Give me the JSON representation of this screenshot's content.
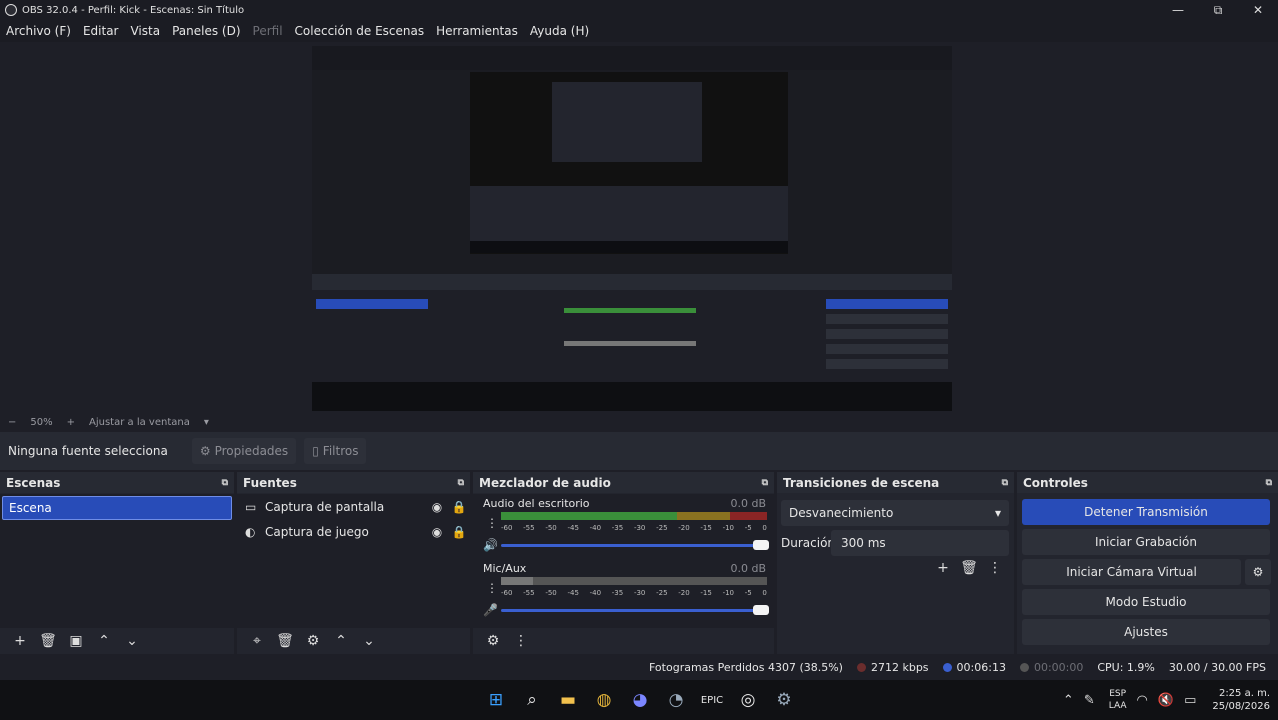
{
  "window": {
    "title": "OBS 32.0.4 - Perfil: Kick - Escenas: Sin Título",
    "minimize": "—",
    "maximize": "⧉",
    "close": "✕"
  },
  "menu": [
    "Archivo (F)",
    "Editar",
    "Vista",
    "Paneles (D)",
    "Perfil",
    "Colección de Escenas",
    "Herramientas",
    "Ayuda (H)"
  ],
  "zoom": {
    "minus": "−",
    "level": "50%",
    "plus": "+",
    "fit": "Ajustar a la ventana",
    "caret": "▾"
  },
  "source_toolbar": {
    "none_selected": "Ninguna fuente selecciona",
    "properties": "Propiedades",
    "filters": "Filtros"
  },
  "scenes": {
    "title": "Escenas",
    "items": [
      "Escena"
    ]
  },
  "sources": {
    "title": "Fuentes",
    "items": [
      {
        "label": "Captura de pantalla",
        "icon": "monitor-icon"
      },
      {
        "label": "Captura de juego",
        "icon": "gamepad-icon"
      }
    ]
  },
  "mixer": {
    "title": "Mezclador de audio",
    "ticks": [
      "-60",
      "-55",
      "-50",
      "-45",
      "-40",
      "-35",
      "-30",
      "-25",
      "-20",
      "-15",
      "-10",
      "-5",
      "0"
    ],
    "channels": [
      {
        "name": "Audio del escritorio",
        "db": "0.0 dB",
        "muted": false
      },
      {
        "name": "Mic/Aux",
        "db": "0.0 dB",
        "muted": true
      }
    ]
  },
  "transitions": {
    "title": "Transiciones de escena",
    "selected": "Desvanecimiento",
    "duration_label": "Duración",
    "duration_value": "300 ms"
  },
  "controls": {
    "title": "Controles",
    "stop_stream": "Detener Transmisión",
    "start_record": "Iniciar Grabación",
    "virtual_cam": "Iniciar Cámara Virtual",
    "studio_mode": "Modo Estudio",
    "settings": "Ajustes"
  },
  "status": {
    "dropped_frames": "Fotogramas Perdidos 4307 (38.5%)",
    "bitrate": "2712 kbps",
    "stream_time": "00:06:13",
    "record_time": "00:00:00",
    "cpu": "CPU: 1.9%",
    "fps": "30.00 / 30.00 FPS"
  },
  "taskbar": {
    "lang_top": "ESP",
    "lang_bottom": "LAA",
    "time": "2:25 a. m.",
    "date": "25/08/2026"
  },
  "colors": {
    "accent": "#284cb8",
    "background": "#1e1f27",
    "dock": "#23252e"
  }
}
